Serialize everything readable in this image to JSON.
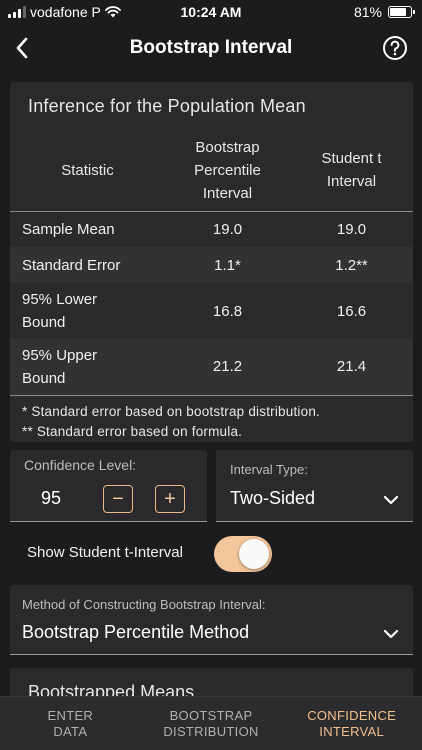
{
  "status_bar": {
    "carrier": "vodafone P",
    "time": "10:24 AM",
    "battery": "81%",
    "battery_level": 0.81
  },
  "nav": {
    "title": "Bootstrap Interval",
    "back_icon": "chevron-left-icon",
    "help_icon": "question-circle-icon"
  },
  "inference": {
    "title": "Inference for the Population Mean",
    "headers": {
      "statistic": "Statistic",
      "bootstrap": [
        "Bootstrap",
        "Percentile",
        "Interval"
      ],
      "student": [
        "Student t",
        "Interval"
      ]
    },
    "rows": [
      {
        "label": [
          "Sample Mean"
        ],
        "bootstrap": "19.0",
        "student": "19.0"
      },
      {
        "label": [
          "Standard Error"
        ],
        "bootstrap": "1.1*",
        "student": "1.2**"
      },
      {
        "label": [
          "95% Lower",
          "Bound"
        ],
        "bootstrap": "16.8",
        "student": "16.6"
      },
      {
        "label": [
          "95% Upper",
          "Bound"
        ],
        "bootstrap": "21.2",
        "student": "21.4"
      }
    ],
    "footnotes": [
      "* Standard error based on bootstrap distribution.",
      "** Standard error based on formula."
    ]
  },
  "confidence": {
    "label": "Confidence Level:",
    "value": "95",
    "decrement": "−",
    "increment": "+"
  },
  "interval_type": {
    "label": "Interval Type:",
    "value": "Two-Sided"
  },
  "student_toggle": {
    "label": "Show Student t-Interval",
    "on": true
  },
  "method": {
    "label": "Method of Constructing Bootstrap Interval:",
    "value": "Bootstrap Percentile Method"
  },
  "means": {
    "title": "Bootstrapped Means"
  },
  "tabs": [
    {
      "line1": "ENTER",
      "line2": "DATA",
      "active": false
    },
    {
      "line1": "BOOTSTRAP",
      "line2": "DISTRIBUTION",
      "active": false
    },
    {
      "line1": "CONFIDENCE",
      "line2": "INTERVAL",
      "active": true
    }
  ],
  "colors": {
    "accent": "#f3c59a",
    "background": "#1c1c1e",
    "card": "#2a2a2c"
  }
}
